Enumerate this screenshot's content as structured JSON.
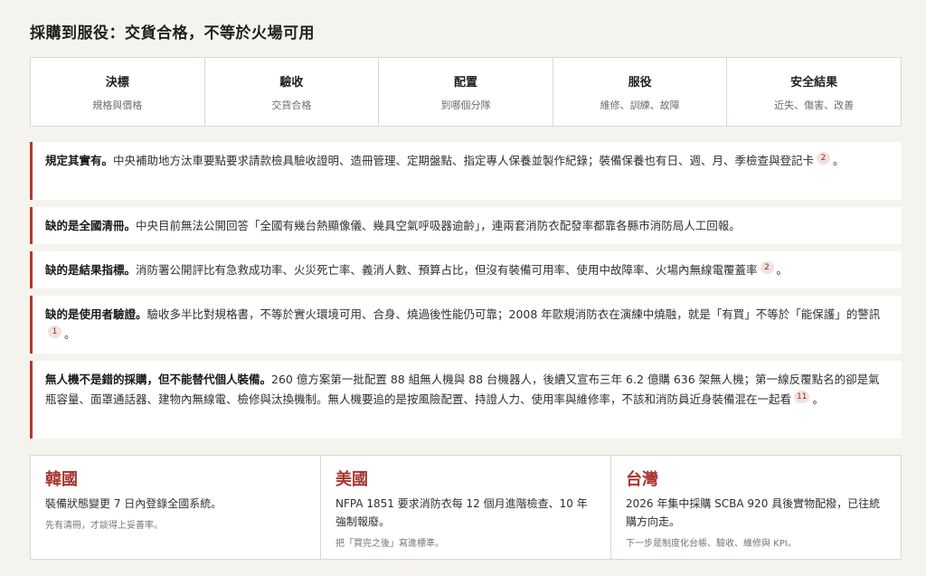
{
  "page": {
    "title": "採購到服役：交貨合格，不等於火場可用"
  },
  "stages": [
    {
      "name": "決標",
      "sub": "規格與價格"
    },
    {
      "name": "驗收",
      "sub": "交貨合格"
    },
    {
      "name": "配置",
      "sub": "到哪個分隊"
    },
    {
      "name": "服役",
      "sub": "維修、訓練、故障"
    },
    {
      "name": "安全結果",
      "sub": "近失、傷害、改善"
    }
  ],
  "notes": [
    {
      "lead": "規定其實有。",
      "body": "中央補助地方汰車要點要求請款檢具驗收證明、造冊管理、定期盤點、指定專人保養並製作紀錄；裝備保養也有日、週、月、季檢查與登記卡",
      "cite": "2",
      "tail": "。"
    },
    {
      "lead": "缺的是全國清冊。",
      "body": "中央目前無法公開回答「全國有幾台熱顯像儀、幾具空氣呼吸器逾齡」，連兩套消防衣配發率都靠各縣市消防局人工回報。",
      "cite": "",
      "tail": ""
    },
    {
      "lead": "缺的是結果指標。",
      "body": "消防署公開評比有急救成功率、火災死亡率、義消人數、預算占比，但沒有裝備可用率、使用中故障率、火場內無線電覆蓋率",
      "cite": "2",
      "tail": "。"
    },
    {
      "lead": "缺的是使用者驗證。",
      "body": "驗收多半比對規格書，不等於實火環境可用、合身、燒過後性能仍可靠；2008 年歐規消防衣在演練中燒融，就是「有買」不等於「能保護」的警訊",
      "cite": "1",
      "tail": "。"
    },
    {
      "lead": "無人機不是錯的採購，但不能替代個人裝備。",
      "body": "260 億方案第一批配置 88 組無人機與 88 台機器人，後續又宣布三年 6.2 億購 636 架無人機；第一線反覆點名的卻是氣瓶容量、面罩通話器、建物內無線電、檢修與汰換機制。無人機要追的是按風險配置、持證人力、使用率與維修率，不該和消防員近身裝備混在一起看",
      "cite": "11",
      "tail": "。"
    }
  ],
  "countries": [
    {
      "name": "韓國",
      "desc": "裝備狀態變更 7 日內登錄全國系統。",
      "note": "先有清冊，才談得上妥善率。"
    },
    {
      "name": "美國",
      "desc": "NFPA 1851 要求消防衣每 12 個月進階檢查、10 年強制報廢。",
      "note": "把「買完之後」寫進標準。"
    },
    {
      "name": "台灣",
      "desc": "2026 年集中採購 SCBA 920 具後實物配撥，已往統購方向走。",
      "note": "下一步是制度化台帳、驗收、維修與 KPI。"
    }
  ]
}
